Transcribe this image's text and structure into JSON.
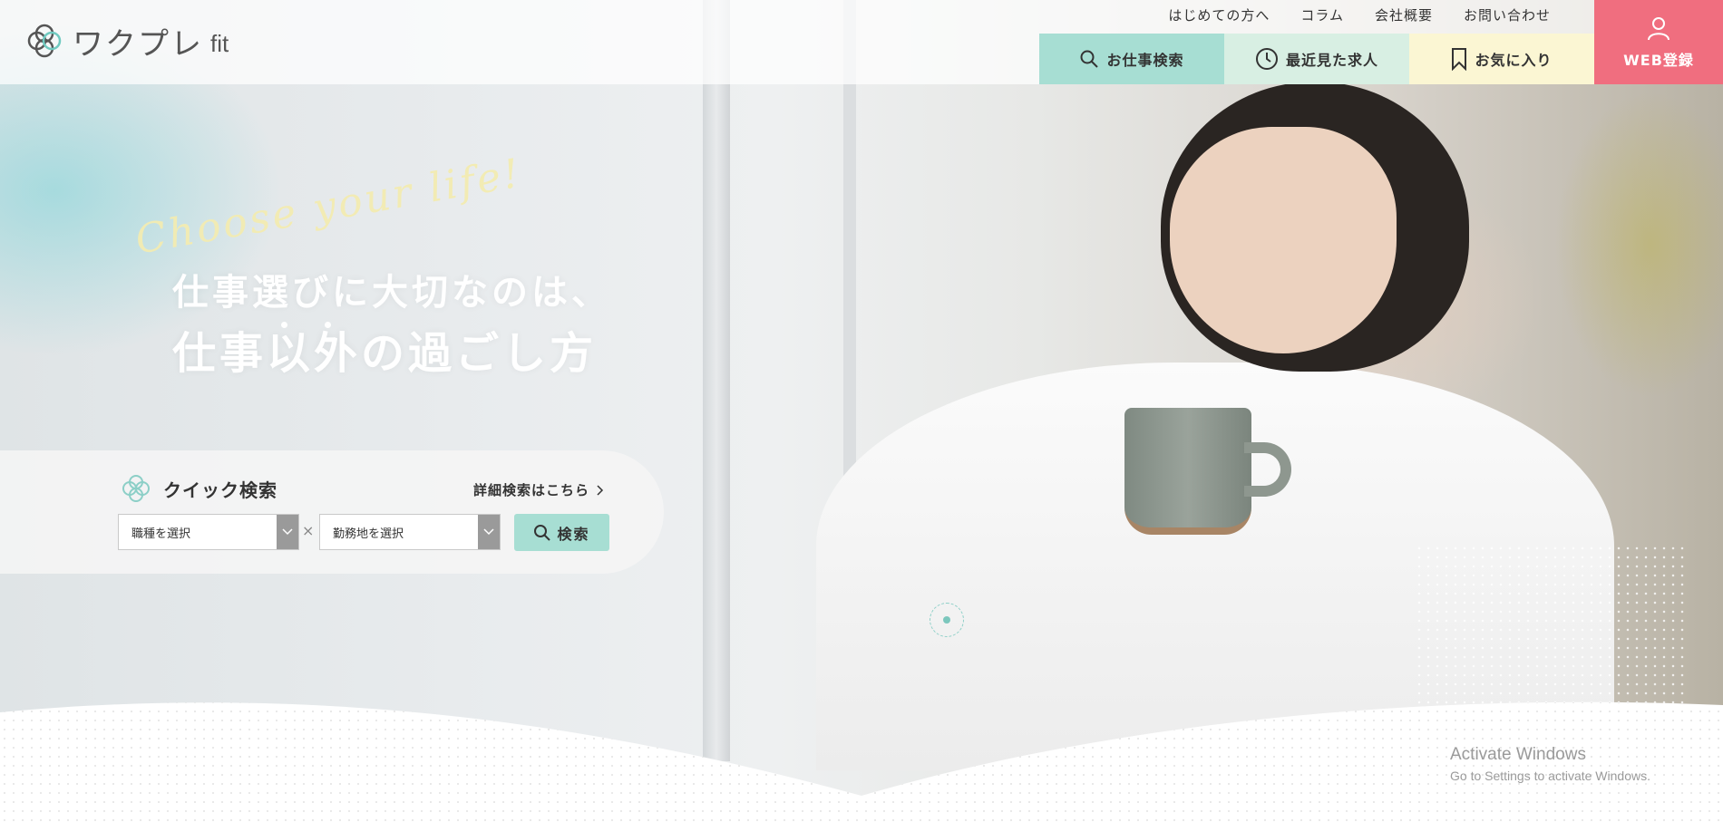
{
  "brand": {
    "logo_text": "ワクプレ",
    "logo_sub": "fit",
    "accent_mint": "#a7ded3",
    "accent_pink": "#f06e7f"
  },
  "topnav": {
    "items": [
      {
        "label": "はじめての方へ"
      },
      {
        "label": "コラム"
      },
      {
        "label": "会社概要"
      },
      {
        "label": "お問い合わせ"
      }
    ]
  },
  "main_nav": {
    "search": {
      "label": "お仕事検索",
      "icon": "search-icon"
    },
    "recent": {
      "label": "最近見た求人",
      "icon": "clock-icon"
    },
    "favorite": {
      "label": "お気に入り",
      "icon": "bookmark-icon"
    }
  },
  "register": {
    "label": "WEB登録",
    "icon": "user-icon"
  },
  "hero": {
    "script_text": "Choose your life!",
    "headline_line1": "仕事選びに大切なのは、",
    "headline_line2": "仕事以外の過ごし方"
  },
  "quick_search": {
    "title": "クイック検索",
    "detail_link": "詳細検索はこちら",
    "job_type_select": "職種を選択",
    "location_select": "勤務地を選択",
    "separator": "×",
    "search_button": "検索"
  },
  "watermark": {
    "line1": "Activate Windows",
    "line2": "Go to Settings to activate Windows."
  }
}
